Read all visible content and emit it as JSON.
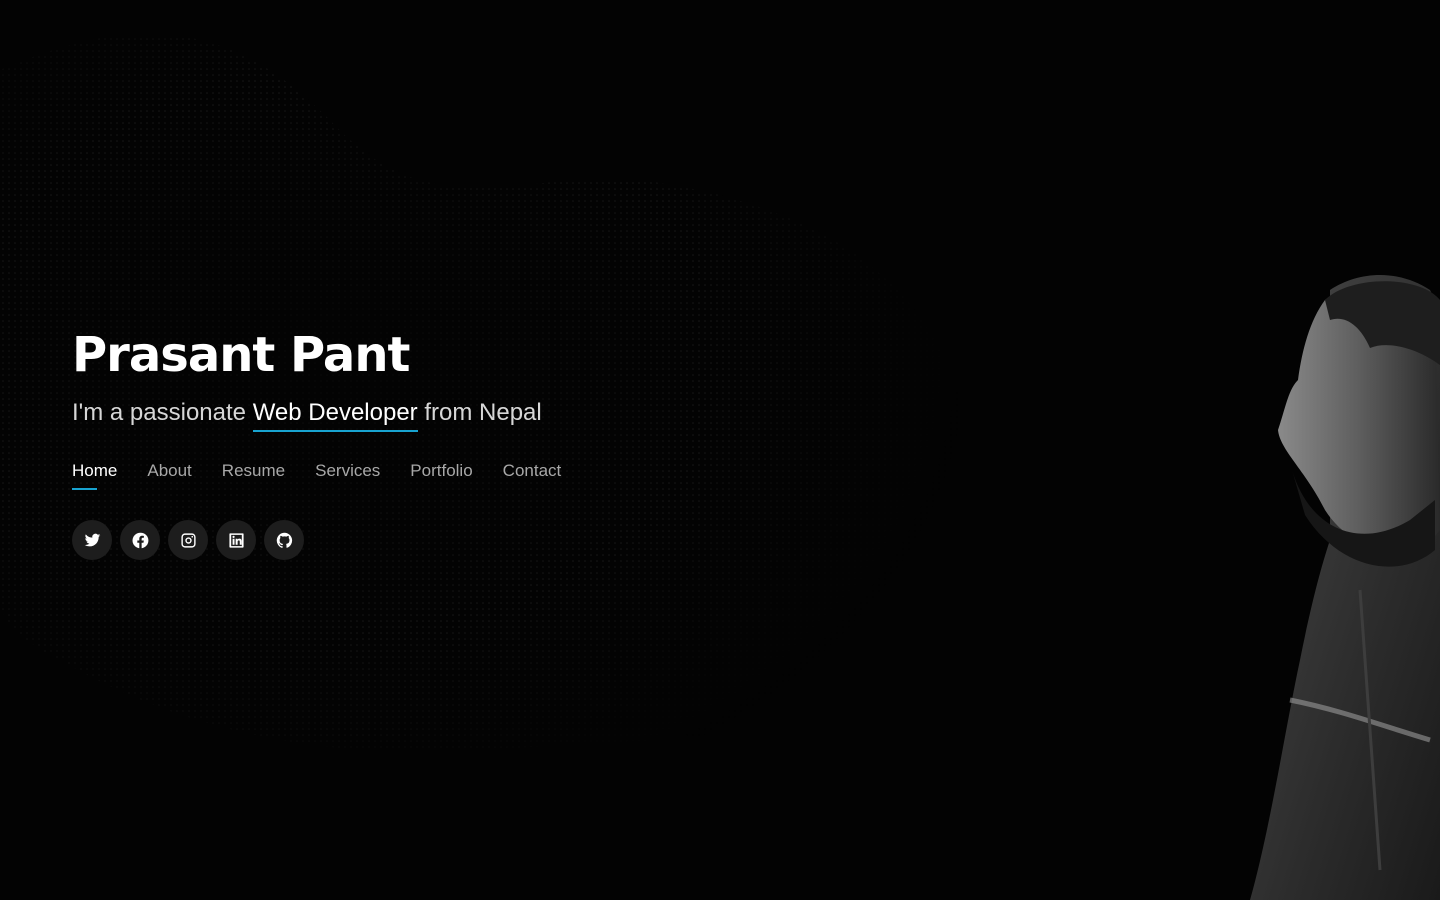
{
  "hero": {
    "name": "Prasant Pant",
    "tagline_prefix": "I'm a passionate ",
    "role": "Web Developer",
    "tagline_suffix": " from Nepal"
  },
  "nav": {
    "items": [
      {
        "label": "Home",
        "active": true
      },
      {
        "label": "About"
      },
      {
        "label": "Resume"
      },
      {
        "label": "Services"
      },
      {
        "label": "Portfolio"
      },
      {
        "label": "Contact"
      }
    ]
  },
  "social": [
    {
      "icon": "twitter-icon"
    },
    {
      "icon": "facebook-icon"
    },
    {
      "icon": "instagram-icon"
    },
    {
      "icon": "linkedin-icon"
    },
    {
      "icon": "github-icon"
    }
  ],
  "colors": {
    "background": "#030303",
    "accent": "#18a3d0",
    "nav_inactive": "#a8a8a8",
    "icon_circle": "#1d1d1d"
  }
}
